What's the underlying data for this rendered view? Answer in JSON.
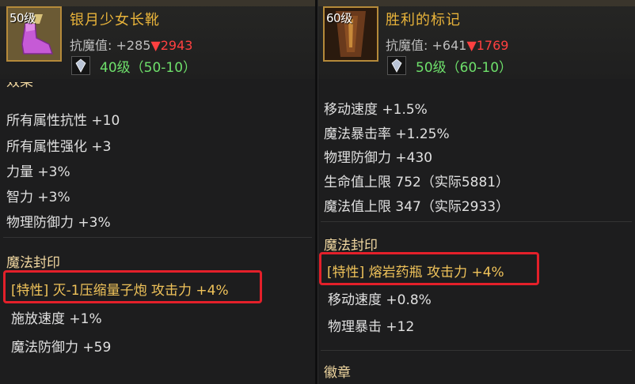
{
  "left_item": {
    "level_tag": "50级",
    "name": "银月少女长靴",
    "resist_label": "抗魔值: ",
    "resist_value": "+285",
    "resist_down": "▼2943",
    "level_req": "40级（50-10）",
    "partial_header": "效果",
    "stats": [
      "所有属性抗性 +10",
      "所有属性强化 +3",
      "力量 +3%",
      "智力 +3%",
      "物理防御力 +3%"
    ],
    "seal_title": "魔法封印",
    "trait": "[特性] 灭-1压缩量子炮 攻击力 +4%",
    "seal_stats": [
      "施放速度 +1%",
      "魔法防御力 +59"
    ]
  },
  "right_item": {
    "level_tag": "60级",
    "name": "胜利的标记",
    "resist_label": "抗魔值: ",
    "resist_value": "+641",
    "resist_down": "▼1769",
    "level_req": "50级（60-10）",
    "stats": [
      "移动速度 +1.5%",
      "魔法暴击率 +1.25%",
      "物理防御力 +430",
      "生命值上限 752（实际5881）",
      "魔法值上限 347（实际2933）"
    ],
    "seal_title": "魔法封印",
    "trait": "[特性] 熔岩药瓶 攻击力 +4%",
    "seal_stats": [
      "移动速度 +0.8%",
      "物理暴击 +12"
    ],
    "badge_title": "徽章"
  },
  "colors": {
    "title": "#e8b33a",
    "level_req": "#6ee06b",
    "resist_down": "#ff4040",
    "highlight_box": "#e4202a",
    "trait_text": "#f0c35a"
  }
}
